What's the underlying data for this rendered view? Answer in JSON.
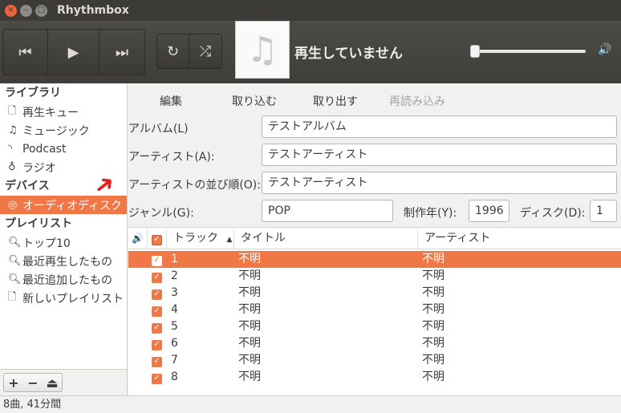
{
  "window": {
    "title": "Rhythmbox",
    "controls": {
      "close": "×",
      "minimize": "–",
      "maximize": "□"
    }
  },
  "toolbar": {
    "previous_icon": "⏮",
    "play_icon": "▶",
    "next_icon": "⏭",
    "repeat_icon": "↻",
    "shuffle_icon": "⤮",
    "album_art_icon": "♫",
    "now_playing": "再生していません",
    "volume_icon": "🔊",
    "volume_level": 0.0
  },
  "sidebar": {
    "sections": [
      {
        "heading": "ライブラリ",
        "items": [
          {
            "label": "再生キュー",
            "icon": "document-icon"
          },
          {
            "label": "ミュージック",
            "icon": "music-note-icon"
          },
          {
            "label": "Podcast",
            "icon": "rss-icon"
          },
          {
            "label": "ラジオ",
            "icon": "radio-icon"
          }
        ]
      },
      {
        "heading": "デバイス",
        "items": [
          {
            "label": "オーディオディスク",
            "icon": "cd-icon",
            "selected": true
          }
        ]
      },
      {
        "heading": "プレイリスト",
        "items": [
          {
            "label": "トップ10",
            "icon": "search-icon"
          },
          {
            "label": "最近再生したもの",
            "icon": "search-icon"
          },
          {
            "label": "最近追加したもの",
            "icon": "search-icon"
          },
          {
            "label": "新しいプレイリスト",
            "icon": "document-icon"
          }
        ]
      }
    ],
    "bottom_buttons": {
      "add": "+",
      "remove": "−",
      "eject": "⏏"
    }
  },
  "actions": {
    "edit": "編集",
    "import": "取り込む",
    "extract": "取り出す",
    "reload": "再読み込み"
  },
  "form": {
    "album_label": "アルバム(L)",
    "album_value": "テストアルバム",
    "artist_label": "アーティスト(A):",
    "artist_value": "テストアーティスト",
    "artist_sort_label": "アーティストの並び順(O):",
    "artist_sort_value": "テストアーティスト",
    "genre_label": "ジャンル(G):",
    "genre_value": "POP",
    "year_label": "制作年(Y):",
    "year_value": "1996",
    "disc_label": "ディスク(D):",
    "disc_value": "1"
  },
  "table": {
    "columns": {
      "track": "トラック",
      "title": "タイトル",
      "artist": "アーティスト"
    },
    "sort_indicator": "▲",
    "rows": [
      {
        "track": "1",
        "title": "不明",
        "artist": "不明",
        "selected": true
      },
      {
        "track": "2",
        "title": "不明",
        "artist": "不明"
      },
      {
        "track": "3",
        "title": "不明",
        "artist": "不明"
      },
      {
        "track": "4",
        "title": "不明",
        "artist": "不明"
      },
      {
        "track": "5",
        "title": "不明",
        "artist": "不明"
      },
      {
        "track": "6",
        "title": "不明",
        "artist": "不明"
      },
      {
        "track": "7",
        "title": "不明",
        "artist": "不明"
      },
      {
        "track": "8",
        "title": "不明",
        "artist": "不明"
      }
    ]
  },
  "status": "8曲, 41分間",
  "colors": {
    "accent": "#f07746",
    "annotation_arrow": "#e0201c",
    "titlebar": "#3c3b37"
  }
}
